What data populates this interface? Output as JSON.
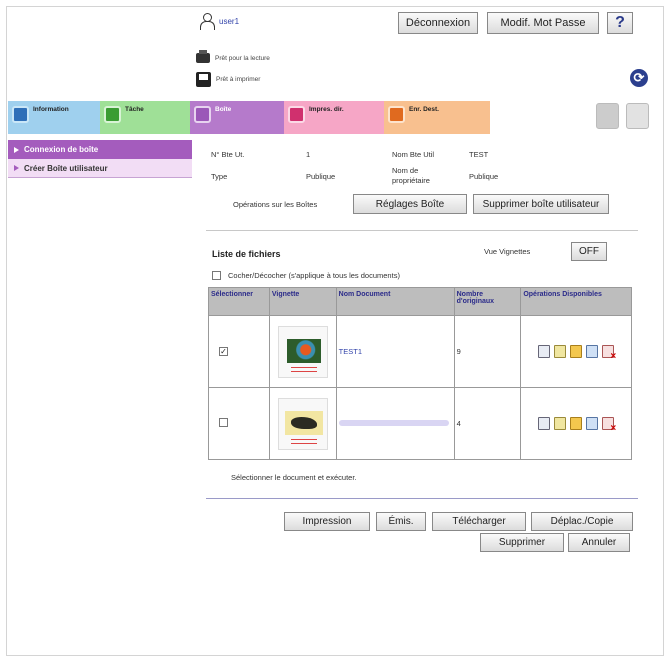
{
  "header": {
    "user": "user1",
    "logout_label": "Déconnexion",
    "change_password_label": "Modif. Mot Passe",
    "help_label": "?",
    "status_ready_read": "Prêt pour la lecture",
    "status_ready_print": "Prêt à imprimer"
  },
  "tabs": [
    {
      "label": "Information"
    },
    {
      "label": "Tâche"
    },
    {
      "label": "Boîte"
    },
    {
      "label": "Impres. dir."
    },
    {
      "label": "Enr. Dest."
    }
  ],
  "sidebar": {
    "items": [
      {
        "label": "Connexion de boîte"
      },
      {
        "label": "Créer Boîte utilisateur"
      }
    ]
  },
  "box_info": {
    "box_no_label": "N° Bte Ut.",
    "box_no_value": "1",
    "box_name_label": "Nom Bte Util",
    "box_name_value": "TEST",
    "type_label": "Type",
    "type_value": "Publique",
    "owner_label": "Nom de propriétaire",
    "owner_value": "Publique",
    "ops_label": "Opérations sur les Boîtes",
    "settings_button": "Réglages Boîte",
    "delete_box_button": "Supprimer boîte utilisateur"
  },
  "file_list": {
    "title": "Liste de fichiers",
    "thumbnail_view_label": "Vue Vignettes",
    "thumbnail_toggle": "OFF",
    "select_all_label": "Cocher/Décocher (s'applique à tous les documents)",
    "columns": [
      "Sélectionner",
      "Vignette",
      "Nom Document",
      "Nombre d'originaux",
      "Opérations Disponibles"
    ],
    "rows": [
      {
        "checked": "✓",
        "name": "TEST1",
        "count": "9"
      },
      {
        "checked": "",
        "name": "",
        "count": "4"
      }
    ],
    "hint": "Sélectionner le document et exécuter."
  },
  "actions": {
    "print": "Impression",
    "send": "Émis.",
    "download": "Télécharger",
    "move_copy": "Déplac./Copie",
    "delete": "Supprimer",
    "cancel": "Annuler"
  }
}
